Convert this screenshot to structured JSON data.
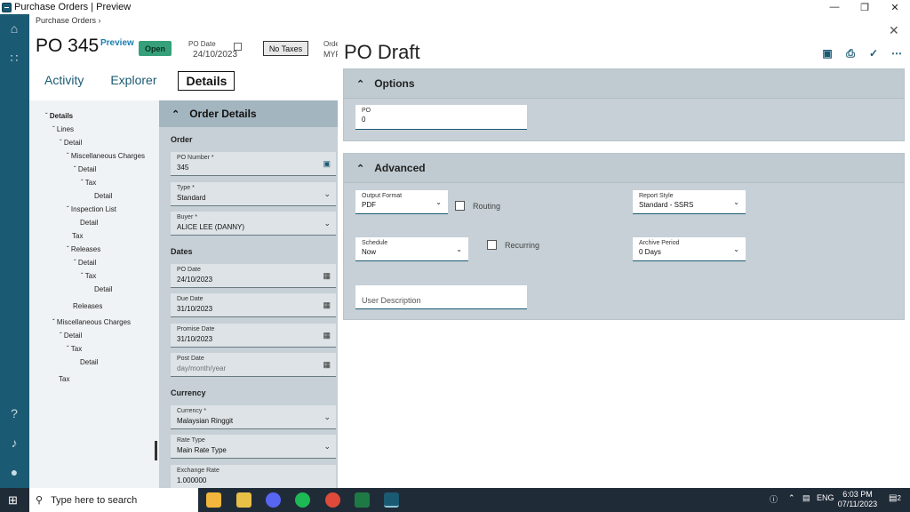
{
  "window": {
    "title": "Purchase Orders | Preview"
  },
  "background": {
    "breadcrumb": "Purchase Orders",
    "po_title": "PO 345",
    "preview_label": "Preview",
    "status": "Open",
    "po_date_label": "PO Date",
    "po_date_value": "24/10/2023",
    "taxes_button": "No Taxes",
    "ord_label": "Orde",
    "ord_value": "MYF",
    "tabs": [
      "Activity",
      "Explorer",
      "Details"
    ],
    "tree": [
      "Details",
      "Lines",
      "Detail",
      "Miscellaneous Charges",
      "Detail",
      "Tax",
      "Detail",
      "Inspection List",
      "Detail",
      "Tax",
      "Releases",
      "Detail",
      "Tax",
      "Detail",
      "Releases",
      "Miscellaneous Charges",
      "Detail",
      "Tax",
      "Detail",
      "Tax"
    ],
    "order_details": {
      "header": "Order Details",
      "order_section": "Order",
      "dates_section": "Dates",
      "currency_section": "Currency",
      "fields": [
        {
          "label": "PO Number *",
          "value": "345"
        },
        {
          "label": "Type *",
          "value": "Standard"
        },
        {
          "label": "Buyer *",
          "value": "ALICE LEE (DANNY)"
        },
        {
          "label": "PO Date",
          "value": "24/10/2023"
        },
        {
          "label": "Due Date",
          "value": "31/10/2023"
        },
        {
          "label": "Promise Date",
          "value": "31/10/2023"
        },
        {
          "label": "Post Date",
          "value": "day/month/year"
        },
        {
          "label": "Currency *",
          "value": "Malaysian Ringgit"
        },
        {
          "label": "Rate Type",
          "value": "Main Rate Type"
        },
        {
          "label": "Exchange Rate",
          "value": "1.000000"
        }
      ]
    }
  },
  "panel": {
    "title": "PO Draft",
    "options": {
      "header": "Options",
      "po_label": "PO",
      "po_value": "0"
    },
    "advanced": {
      "header": "Advanced",
      "output_format_label": "Output Format",
      "output_format_value": "PDF",
      "routing_label": "Routing",
      "report_style_label": "Report Style",
      "report_style_value": "Standard - SSRS",
      "schedule_label": "Schedule",
      "schedule_value": "Now",
      "recurring_label": "Recurring",
      "archive_period_label": "Archive Period",
      "archive_period_value": "0 Days",
      "user_description_placeholder": "User Description"
    }
  },
  "taskbar": {
    "search_placeholder": "Type here to search",
    "lang": "ENG",
    "time": "6:03 PM",
    "date": "07/11/2023",
    "notification_count": "2"
  }
}
